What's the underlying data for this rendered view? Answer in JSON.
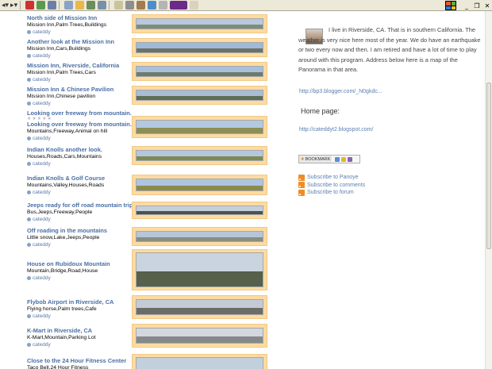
{
  "toolbar": {
    "back_label": "◂▾",
    "forward_label": "▸▾",
    "icons": [
      "stop-icon",
      "refresh-icon",
      "home-icon",
      "search-icon",
      "favorites-icon",
      "media-icon",
      "history-icon",
      "mail-icon",
      "print-icon",
      "edit-icon",
      "messenger-icon",
      "research-icon",
      "yahoo-icon",
      "font-icon"
    ]
  },
  "list": {
    "rows": [
      {
        "title": "North side of Mission Inn",
        "tags": "Mission Inn,Palm Trees,Buildings",
        "user": "cateddy",
        "colors": [
          "#b7c9de",
          "#7f8c7a"
        ]
      },
      {
        "title": "Another look at the Mission Inn",
        "tags": "Mission Inn,Cars,Buildings",
        "user": "cateddy",
        "colors": [
          "#9fb9d9",
          "#6c7366"
        ]
      },
      {
        "title": "Mission Inn, Riverside, California",
        "tags": "Mission Inn,Palm Trees,Cars",
        "user": "cateddy",
        "colors": [
          "#a7c0de",
          "#707a6c"
        ]
      },
      {
        "title": "Mission Inn & Chinese Pavilion",
        "tags": "Mission Inn,Chinese pavilion",
        "user": "cateddy",
        "colors": [
          "#a8bcd4",
          "#5d6d58"
        ]
      },
      {
        "title": "Looking over freeway from mountain.",
        "tags": "",
        "user": "",
        "stars": "★★★★★",
        "colors": []
      },
      {
        "title": "Looking over freeway from mountain.",
        "tags": "Mountains,Freeway,Animal on hill",
        "user": "cateddy",
        "colors": [
          "#b3c9e2",
          "#8d8d57"
        ]
      },
      {
        "title": "Indian Knolls another look.",
        "tags": "Houses,Roads,Cars,Mountains",
        "user": "cateddy",
        "colors": [
          "#b2c8e0",
          "#7f8a55"
        ]
      },
      {
        "title": "Indian Knolls & Golf Course",
        "tags": "Mountains,Valley,Houses,Roads",
        "user": "cateddy",
        "colors": [
          "#aec5e0",
          "#8d8a4c"
        ]
      },
      {
        "title": "Jeeps ready for off road mountain trip.",
        "tags": "Bus,Jeeps,Freeway,People",
        "user": "cateddy",
        "colors": [
          "#c4cfdc",
          "#4f4f4f"
        ]
      },
      {
        "title": "Off roading in the mountains",
        "tags": "Little snow,Lake,Jeeps,People",
        "user": "cateddy",
        "colors": [
          "#b5c6da",
          "#8a8c80"
        ]
      },
      {
        "title": "House on Rubidoux Mountain",
        "tags": "Mountain,Bridge,Road,House",
        "user": "cateddy",
        "colors": [
          "#c9d4df",
          "#56604a"
        ]
      },
      {
        "title": "Flybob Airport in Riverside, CA",
        "tags": "Flying horse,Palm trees,Cafe",
        "user": "cateddy",
        "colors": [
          "#c3ccd5",
          "#6b6c68"
        ]
      },
      {
        "title": "K-Mart in Riverside, CA",
        "tags": "K-Mart,Mountain,Parking Lot",
        "user": "cateddy",
        "colors": [
          "#d2d8de",
          "#86898a"
        ]
      },
      {
        "title": "Close to the 24 Hour Fitness Center",
        "tags": "Taco Bell,24 Hour Fitness",
        "user": "",
        "colors": [
          "#c2d0de",
          "#707870"
        ]
      }
    ]
  },
  "profile": {
    "about": "I live in Riverside, CA. That is in southern California. The weather is very nice here most of the year. We do have an earthquake or two every now and then. I am retired and have a lot of time to play around with this program. Address below here is a map of the Panorama in that area.",
    "about_link": "http://bp3.blogger.com/_N0gkdc...",
    "home_title": "Home page:",
    "home_link": "http://cateddyt2.blogspot.com/",
    "bookmark_label": "BOOKMARK",
    "subscriptions": [
      "Subscribe to Panoye",
      "Subscribe to comments",
      "Subscribe to forum"
    ]
  },
  "colors": {
    "link": "#4a6fa5",
    "thumb_frame": "#fcdba2",
    "rss": "#f08c25"
  }
}
